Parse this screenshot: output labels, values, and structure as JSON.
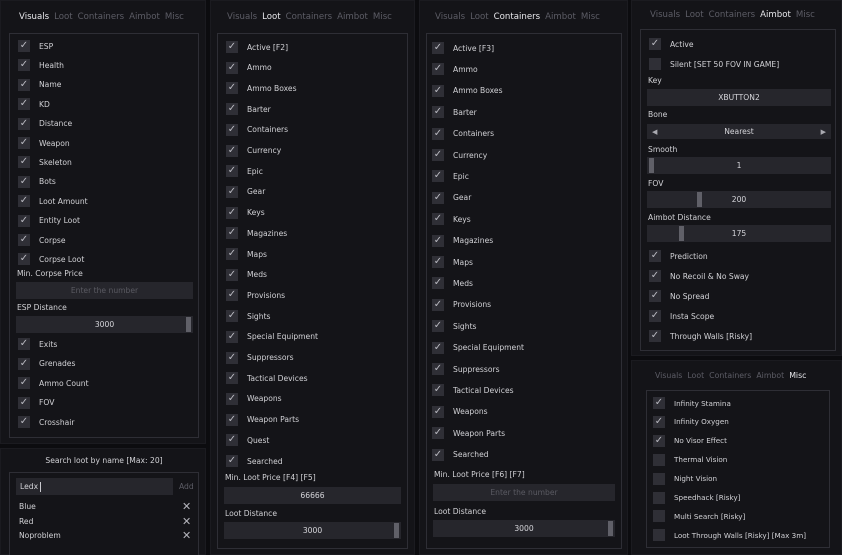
{
  "tabs": [
    "Visuals",
    "Loot",
    "Containers",
    "Aimbot",
    "Misc"
  ],
  "visuals": {
    "items": [
      {
        "label": "ESP",
        "checked": true
      },
      {
        "label": "Health",
        "checked": true
      },
      {
        "label": "Name",
        "checked": true
      },
      {
        "label": "KD",
        "checked": true
      },
      {
        "label": "Distance",
        "checked": true
      },
      {
        "label": "Weapon",
        "checked": true
      },
      {
        "label": "Skeleton",
        "checked": true
      },
      {
        "label": "Bots",
        "checked": true
      },
      {
        "label": "Loot Amount",
        "checked": true
      },
      {
        "label": "Entity Loot",
        "checked": true
      },
      {
        "label": "Corpse",
        "checked": true
      },
      {
        "label": "Corpse Loot",
        "checked": true
      }
    ],
    "min_corpse_price_label": "Min. Corpse Price",
    "min_corpse_price_placeholder": "Enter the number",
    "esp_distance_label": "ESP Distance",
    "esp_distance_value": "3000",
    "items2": [
      {
        "label": "Exits",
        "checked": true
      },
      {
        "label": "Grenades",
        "checked": true
      },
      {
        "label": "Ammo Count",
        "checked": true
      },
      {
        "label": "FOV",
        "checked": true
      },
      {
        "label": "Crosshair",
        "checked": true
      }
    ]
  },
  "search": {
    "title": "Search loot by name [Max: 20]",
    "input_value": "Ledx",
    "add_label": "Add",
    "items": [
      "Blue",
      "Red",
      "Noproblem"
    ],
    "remove_glyph": "✕"
  },
  "loot": {
    "items": [
      {
        "label": "Active [F2]",
        "checked": true
      },
      {
        "label": "Ammo",
        "checked": true
      },
      {
        "label": "Ammo Boxes",
        "checked": true
      },
      {
        "label": "Barter",
        "checked": true
      },
      {
        "label": "Containers",
        "checked": true
      },
      {
        "label": "Currency",
        "checked": true
      },
      {
        "label": "Epic",
        "checked": true
      },
      {
        "label": "Gear",
        "checked": true
      },
      {
        "label": "Keys",
        "checked": true
      },
      {
        "label": "Magazines",
        "checked": true
      },
      {
        "label": "Maps",
        "checked": true
      },
      {
        "label": "Meds",
        "checked": true
      },
      {
        "label": "Provisions",
        "checked": true
      },
      {
        "label": "Sights",
        "checked": true
      },
      {
        "label": "Special Equipment",
        "checked": true
      },
      {
        "label": "Suppressors",
        "checked": true
      },
      {
        "label": "Tactical Devices",
        "checked": true
      },
      {
        "label": "Weapons",
        "checked": true
      },
      {
        "label": "Weapon Parts",
        "checked": true
      },
      {
        "label": "Quest",
        "checked": true
      },
      {
        "label": "Searched",
        "checked": true
      }
    ],
    "min_price_label": "Min. Loot Price [F4] [F5]",
    "min_price_value": "66666",
    "distance_label": "Loot Distance",
    "distance_value": "3000"
  },
  "containers": {
    "items": [
      {
        "label": "Active [F3]",
        "checked": true
      },
      {
        "label": "Ammo",
        "checked": true
      },
      {
        "label": "Ammo Boxes",
        "checked": true
      },
      {
        "label": "Barter",
        "checked": true
      },
      {
        "label": "Containers",
        "checked": true
      },
      {
        "label": "Currency",
        "checked": true
      },
      {
        "label": "Epic",
        "checked": true
      },
      {
        "label": "Gear",
        "checked": true
      },
      {
        "label": "Keys",
        "checked": true
      },
      {
        "label": "Magazines",
        "checked": true
      },
      {
        "label": "Maps",
        "checked": true
      },
      {
        "label": "Meds",
        "checked": true
      },
      {
        "label": "Provisions",
        "checked": true
      },
      {
        "label": "Sights",
        "checked": true
      },
      {
        "label": "Special Equipment",
        "checked": true
      },
      {
        "label": "Suppressors",
        "checked": true
      },
      {
        "label": "Tactical Devices",
        "checked": true
      },
      {
        "label": "Weapons",
        "checked": true
      },
      {
        "label": "Weapon Parts",
        "checked": true
      },
      {
        "label": "Searched",
        "checked": true
      }
    ],
    "min_price_label": "Min. Loot Price [F6] [F7]",
    "min_price_placeholder": "Enter the number",
    "distance_label": "Loot Distance",
    "distance_value": "3000"
  },
  "aimbot": {
    "active_label": "Active",
    "active_checked": true,
    "silent_label": "Silent [SET 50 FOV IN GAME]",
    "silent_checked": false,
    "key_label": "Key",
    "key_value": "XBUTTON2",
    "bone_label": "Bone",
    "bone_value": "Nearest",
    "smooth_label": "Smooth",
    "smooth_value": "1",
    "fov_label": "FOV",
    "fov_value": "200",
    "aim_distance_label": "Aimbot Distance",
    "aim_distance_value": "175",
    "items": [
      {
        "label": "Prediction",
        "checked": true
      },
      {
        "label": "No Recoil & No Sway",
        "checked": true
      },
      {
        "label": "No Spread",
        "checked": true
      },
      {
        "label": "Insta Scope",
        "checked": true
      },
      {
        "label": "Through Walls [Risky]",
        "checked": true
      }
    ]
  },
  "misc": {
    "items": [
      {
        "label": "Infinity Stamina",
        "checked": true
      },
      {
        "label": "Infinity Oxygen",
        "checked": true
      },
      {
        "label": "No Visor Effect",
        "checked": true
      },
      {
        "label": "Thermal Vision",
        "checked": false
      },
      {
        "label": "Night Vision",
        "checked": false
      },
      {
        "label": "Speedhack [Risky]",
        "checked": false
      },
      {
        "label": "Multi Search [Risky]",
        "checked": false
      },
      {
        "label": "Loot Through Walls [Risky] [Max 3m]",
        "checked": false
      }
    ]
  },
  "icons": {
    "check": "check-icon",
    "remove": "close-icon",
    "left": "arrow-left-icon",
    "right": "arrow-right-icon"
  }
}
